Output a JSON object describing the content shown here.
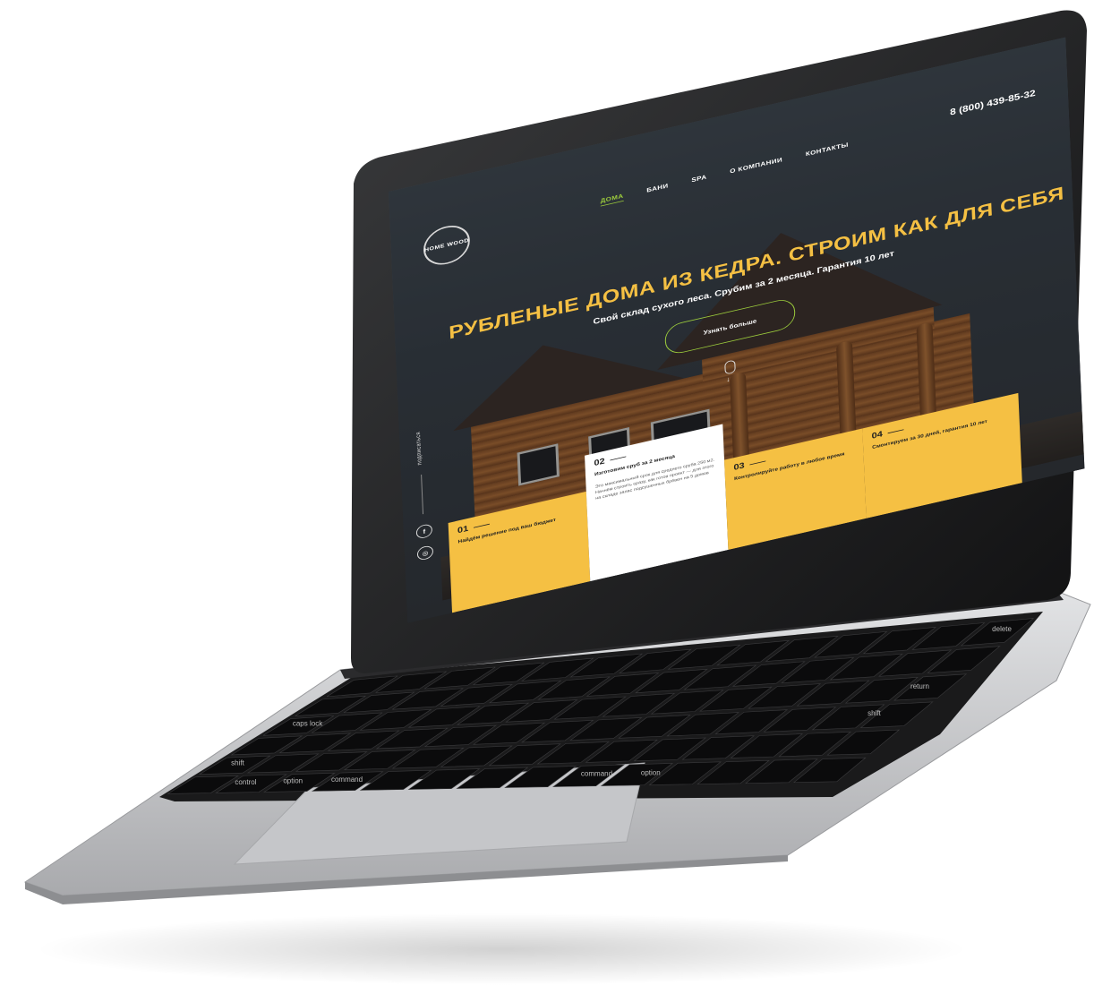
{
  "site": {
    "logo_text": "HOME WOOD",
    "phone": "8 (800) 439-85-32",
    "nav": [
      {
        "label": "ДОМА",
        "active": true
      },
      {
        "label": "БАНИ",
        "active": false
      },
      {
        "label": "SPA",
        "active": false
      },
      {
        "label": "О КОМПАНИИ",
        "active": false
      },
      {
        "label": "КОНТАКТЫ",
        "active": false
      }
    ],
    "hero": {
      "title": "РУБЛЕНЫЕ ДОМА ИЗ КЕДРА. СТРОИМ КАК ДЛЯ СЕБЯ",
      "subtitle": "Свой склад сухого леса. Срубим за 2 месяца. Гарантия 10 лет",
      "cta": "Узнать больше"
    },
    "subscribe_label": "подписаться",
    "social": [
      "f",
      "◎"
    ],
    "features": [
      {
        "num": "01",
        "title": "Найдём решение под ваш бюджет",
        "text": ""
      },
      {
        "num": "02",
        "title": "Изготовим сруб за 2 месяца",
        "text": "Это максимальный срок для среднего сруба 250 м2. Начнём строить сразу, как готов проект — для этого на складе запас подсушенных брёвен на 5 домов"
      },
      {
        "num": "03",
        "title": "Контролируйте работу в любое время",
        "text": ""
      },
      {
        "num": "04",
        "title": "Смонтируем за 30 дней, гарантия 10 лет",
        "text": ""
      }
    ]
  },
  "keyboard": {
    "keys": [
      "delete",
      "return",
      "shift",
      "caps lock",
      "shift",
      "control",
      "option",
      "command",
      "command",
      "option"
    ]
  },
  "colors": {
    "accent_yellow": "#f5c043",
    "accent_green": "#9ccc3c",
    "laptop_silver": "#c9cacc",
    "bezel": "#0f0f10"
  }
}
